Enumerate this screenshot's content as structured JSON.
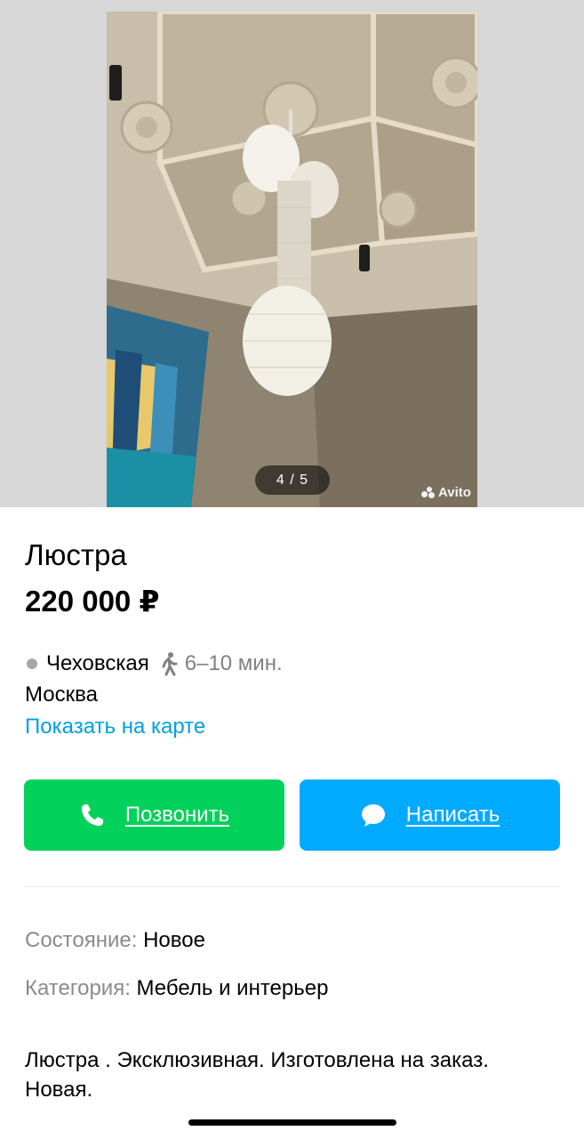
{
  "gallery": {
    "counter": "4 / 5",
    "watermark": "Avito"
  },
  "listing": {
    "title": "Люстра",
    "price": "220 000 ₽",
    "metro_station": "Чеховская",
    "walk_time": "6–10 мин.",
    "city": "Москва",
    "map_link": "Показать на карте"
  },
  "actions": {
    "call_label": "Позвонить",
    "write_label": "Написать"
  },
  "params": [
    {
      "key": "Состояние:",
      "value": "Новое"
    },
    {
      "key": "Категория:",
      "value": "Мебель и интерьер"
    }
  ],
  "description": "Люстра . Эксклюзивная. Изготовлена на заказ. Новая.",
  "colors": {
    "call_button": "#02d15c",
    "write_button": "#00aaff",
    "link": "#00a0e0",
    "metro_dot": "#a6a6a6"
  },
  "icons": {
    "walk": "walking-person-icon",
    "call": "phone-icon",
    "write": "chat-bubble-icon"
  }
}
